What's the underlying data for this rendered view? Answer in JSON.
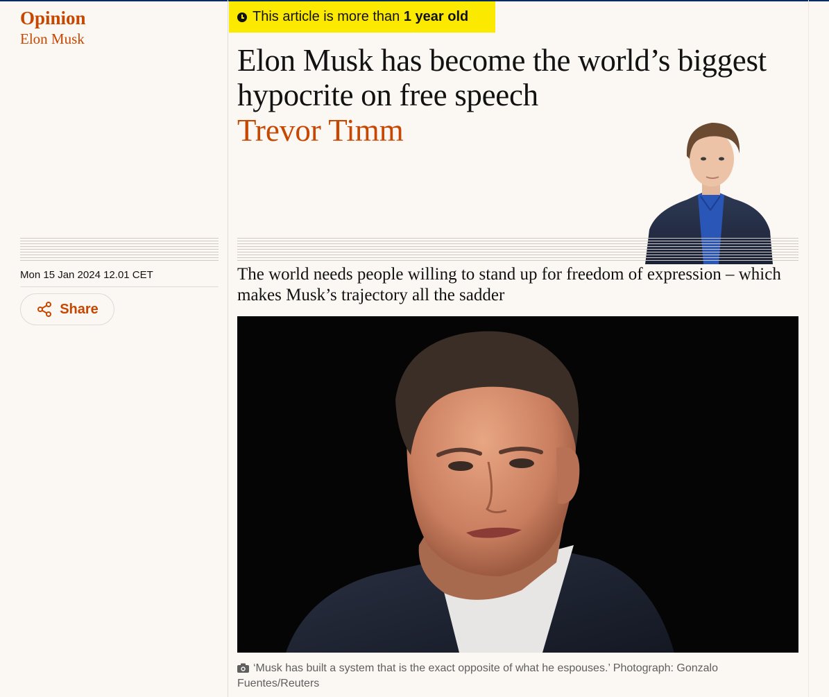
{
  "section": {
    "label": "Opinion",
    "series": "Elon Musk"
  },
  "age_warning": {
    "prefix": "This article is more than ",
    "age": "1 year old",
    "icon": "clock-icon"
  },
  "article": {
    "headline": "Elon Musk has become the world’s biggest hypocrite on free speech",
    "author": "Trevor Timm",
    "standfirst": "The world needs people willing to stand up for freedom of expression – which makes Musk’s trajectory all the sadder",
    "date": "Mon 15 Jan 2024 12.01 CET"
  },
  "share": {
    "label": "Share",
    "icon": "share-icon"
  },
  "image": {
    "caption": "‘Musk has built a system that is the exact opposite of what he espouses.’ Photograph: Gonzalo Fuentes/Reuters",
    "icon": "camera-icon"
  },
  "colors": {
    "accent": "#c74600",
    "badge_bg": "#fce900",
    "page_bg": "#fbf7f3",
    "text": "#121212",
    "caption": "#5f5f5f"
  }
}
